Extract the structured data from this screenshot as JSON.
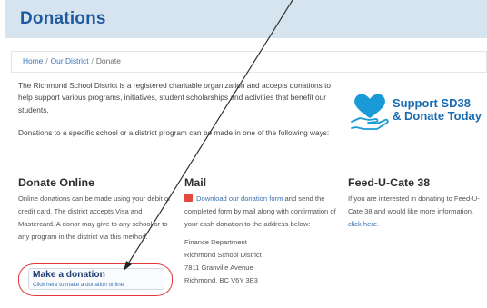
{
  "page": {
    "title": "Donations"
  },
  "breadcrumb": {
    "home": "Home",
    "district": "Our District",
    "current": "Donate",
    "sep": "/"
  },
  "intro": {
    "p1": "The Richmond School District is a registered charitable organization and accepts donations to help support various programs, initiatives, student scholarships and activities that benefit our students.",
    "p2": "Donations to a specific school or a district program can be made in one of the following ways:"
  },
  "logo": {
    "line1": "Support SD38",
    "line2": "& Donate Today",
    "icon": "heart-in-hand-icon",
    "color": "#1a6bb0"
  },
  "online": {
    "heading": "Donate Online",
    "body": "Online donations can be made using your debit or credit card. The district accepts Visa and Mastercard. A donor may give to any school or to any program in the district via this method.",
    "button_label": "Make a donation",
    "button_sub": "Click here to make a donation online."
  },
  "mail": {
    "heading": "Mail",
    "link": "Download our donation form",
    "body": "and send the completed form by mail along with confirmation of your cash donation to the address below:",
    "address": [
      "Finance Department",
      "Richmond School District",
      "7811 Granville Avenue",
      "Richmond, BC  V6Y 3E3"
    ],
    "icon": "pdf-icon"
  },
  "feed": {
    "heading": "Feed-U-Cate 38",
    "body": "If you are interested in donating to Feed-U-Cate 38 and would like more information,",
    "link": "click here."
  },
  "colors": {
    "title": "#1d5aa0",
    "header_band": "#d6e4ef",
    "link": "#3b72b5",
    "annotation": "#e23a3a"
  }
}
